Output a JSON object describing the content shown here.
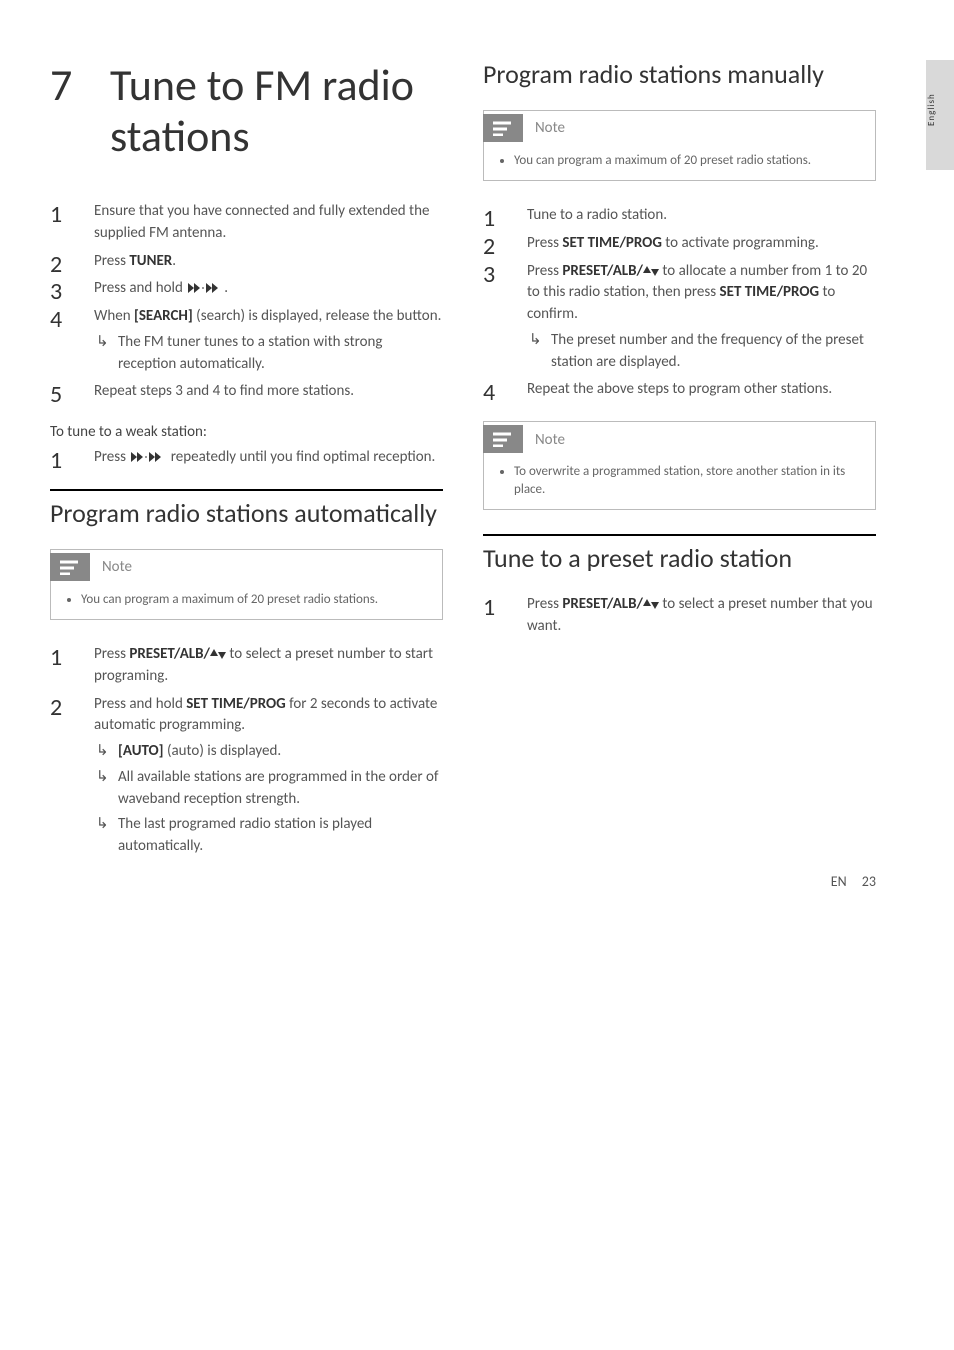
{
  "sideTab": "English",
  "chapter": {
    "num": "7",
    "title": "Tune to FM radio stations"
  },
  "mainSteps": {
    "s1": "Ensure that you have connected and fully extended the supplied FM antenna.",
    "s2a": "Press ",
    "s2b": "TUNER",
    "s2c": ".",
    "s3a": "Press and hold ",
    "s3b": ".",
    "s4a": "When ",
    "s4b": "[SEARCH]",
    "s4c": " (search) is displayed, release the button.",
    "s4sub": "The FM tuner tunes to a station with strong reception automatically.",
    "s5": "Repeat steps 3 and 4 to find more stations."
  },
  "weak": {
    "heading": "To tune to a weak station:",
    "s1a": "Press ",
    "s1b": " repeatedly until you find optimal reception."
  },
  "auto": {
    "heading": "Program radio stations automatically",
    "noteLabel": "Note",
    "noteText": "You can program a maximum of 20 preset radio stations.",
    "s1a": "Press ",
    "s1b": "PRESET/ALB/",
    "s1c": " to select a preset number to start programing.",
    "s2a": "Press and hold ",
    "s2b": "SET TIME/PROG",
    "s2c": " for 2 seconds to activate automatic programming.",
    "s2sub1a": "[AUTO]",
    "s2sub1b": " (auto) is displayed.",
    "s2sub2": "All available stations are programmed in the order of waveband reception strength.",
    "s2sub3": "The last programed radio station is played automatically."
  },
  "manual": {
    "heading": "Program radio stations manually",
    "noteLabel": "Note",
    "noteText": "You can program a maximum of 20 preset radio stations.",
    "s1": "Tune to a radio station.",
    "s2a": "Press ",
    "s2b": "SET TIME/PROG",
    "s2c": " to activate programming.",
    "s3a": "Press ",
    "s3b": "PRESET/ALB/",
    "s3c": " to allocate a number from 1 to 20 to this radio station, then press ",
    "s3d": "SET TIME/PROG",
    "s3e": " to confirm.",
    "s3sub": "The preset number and the frequency of the preset station are displayed.",
    "s4": "Repeat the above steps to program other stations.",
    "note2Label": "Note",
    "note2Text": "To overwrite a programmed station, store another station in its place."
  },
  "preset": {
    "heading": "Tune to a preset radio station",
    "s1a": "Press ",
    "s1b": "PRESET/ALB/",
    "s1c": " to select a preset number that you want."
  },
  "footer": {
    "lang": "EN",
    "page": "23"
  }
}
